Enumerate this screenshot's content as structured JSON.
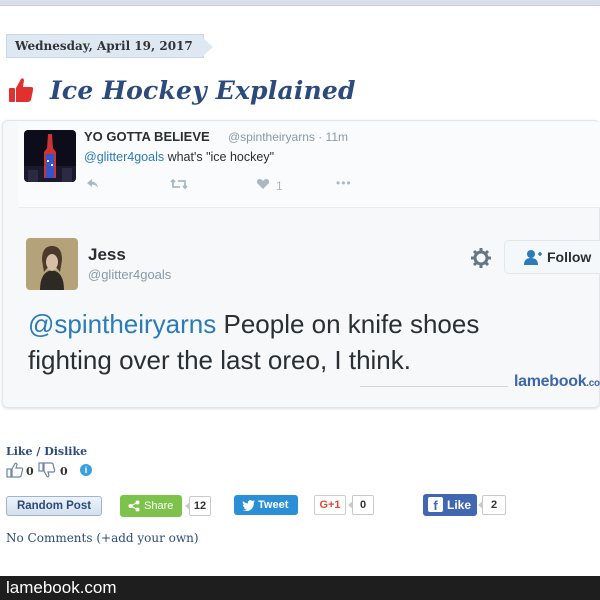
{
  "post": {
    "date": "Wednesday, April 19, 2017",
    "title": "Ice Hockey Explained"
  },
  "reply_tweet": {
    "name": "YO GOTTA BELIEVE",
    "handle_time": "@spintheiryarns · 11m",
    "mention": "@glitter4goals",
    "text": " what's \"ice hockey\"",
    "like_count": "1"
  },
  "main_tweet": {
    "name": "Jess",
    "handle": "@glitter4goals",
    "follow_label": "Follow",
    "mention": "@spintheiryarns",
    "text": " People on knife shoes fighting over the last oreo, I think.",
    "watermark": "lamebook",
    "watermark_suffix": ".co"
  },
  "voting": {
    "label": "Like / Dislike",
    "likes": "0",
    "dislikes": "0"
  },
  "actions": {
    "random_post": "Random Post",
    "share_label": "Share",
    "share_count": "12",
    "tweet_label": "Tweet",
    "gplus_label": "G+1",
    "gplus_count": "0",
    "fb_label": "Like",
    "fb_count": "2"
  },
  "comments": {
    "label": "No Comments (+add your own)"
  },
  "footer": {
    "site": "lamebook.com"
  },
  "colors": {
    "title_blue": "#2c4a7c",
    "twitter_link": "#2b7bb9",
    "thumb_red": "#e0312e",
    "share_green": "#7dc24b",
    "tweet_blue": "#2b8fd6",
    "facebook_blue": "#4267b2"
  }
}
